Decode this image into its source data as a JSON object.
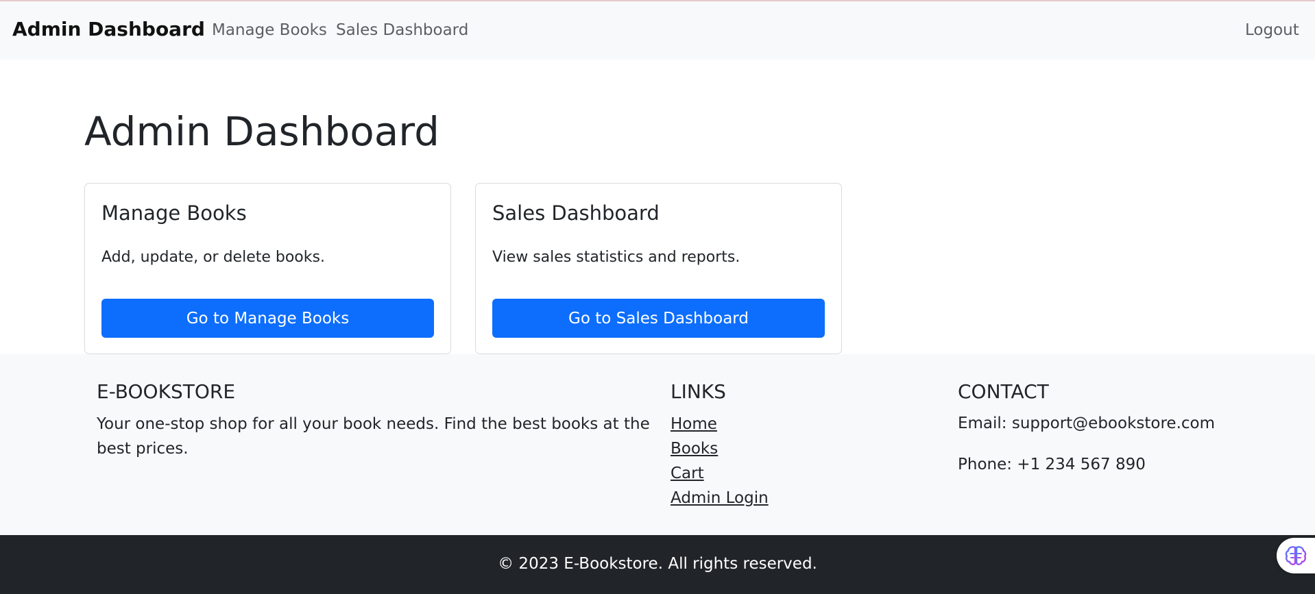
{
  "navbar": {
    "brand": "Admin Dashboard",
    "links": [
      "Manage Books",
      "Sales Dashboard"
    ],
    "logout": "Logout"
  },
  "main": {
    "title": "Admin Dashboard",
    "cards": [
      {
        "title": "Manage Books",
        "text": "Add, update, or delete books.",
        "button": "Go to Manage Books"
      },
      {
        "title": "Sales Dashboard",
        "text": "View sales statistics and reports.",
        "button": "Go to Sales Dashboard"
      }
    ]
  },
  "footer": {
    "about": {
      "heading": "E-BOOKSTORE",
      "text": "Your one-stop shop for all your book needs. Find the best books at the best prices."
    },
    "links": {
      "heading": "LINKS",
      "items": [
        "Home",
        "Books",
        "Cart",
        "Admin Login"
      ]
    },
    "contact": {
      "heading": "CONTACT",
      "email": "Email: support@ebookstore.com",
      "phone": "Phone: +1 234 567 890"
    },
    "copyright": "© 2023 E-Bookstore. All rights reserved."
  },
  "widget": {
    "icon": "brain-icon"
  },
  "colors": {
    "primary": "#0d6efd",
    "navbar_bg": "#f8f9fa",
    "footer_dark": "#212529"
  }
}
